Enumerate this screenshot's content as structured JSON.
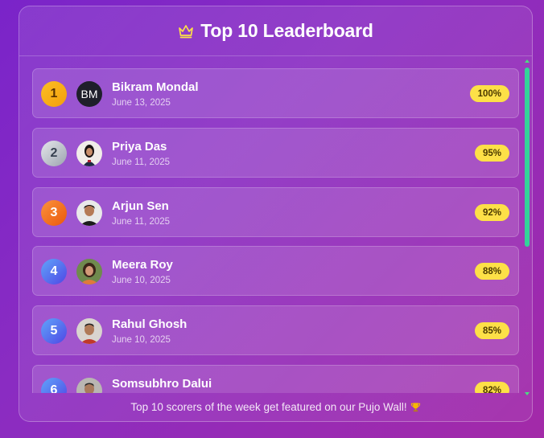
{
  "header": {
    "title": "Top 10 Leaderboard",
    "icon": "crown-icon"
  },
  "colors": {
    "score_badge": "#fde047",
    "gold": "#fbbf24",
    "silver": "#d1d5db",
    "bronze": "#f97316",
    "blue": "#5b6cf0",
    "scrollbar": "#34d399"
  },
  "leaderboard": [
    {
      "rank": "1",
      "name": "Bikram Mondal",
      "date": "June 13, 2025",
      "score": "100%",
      "avatar_initials": "BM",
      "medal": "gold"
    },
    {
      "rank": "2",
      "name": "Priya Das",
      "date": "June 11, 2025",
      "score": "95%",
      "medal": "silver"
    },
    {
      "rank": "3",
      "name": "Arjun Sen",
      "date": "June 11, 2025",
      "score": "92%",
      "medal": "bronze"
    },
    {
      "rank": "4",
      "name": "Meera Roy",
      "date": "June 10, 2025",
      "score": "88%",
      "medal": "blue"
    },
    {
      "rank": "5",
      "name": "Rahul Ghosh",
      "date": "June 10, 2025",
      "score": "85%",
      "medal": "blue"
    },
    {
      "rank": "6",
      "name": "Somsubhro Dalui",
      "date": "",
      "score": "82%",
      "medal": "blue"
    }
  ],
  "footer": {
    "text": "Top 10 scorers of the week get featured on our Pujo Wall!",
    "icon": "trophy-icon"
  }
}
